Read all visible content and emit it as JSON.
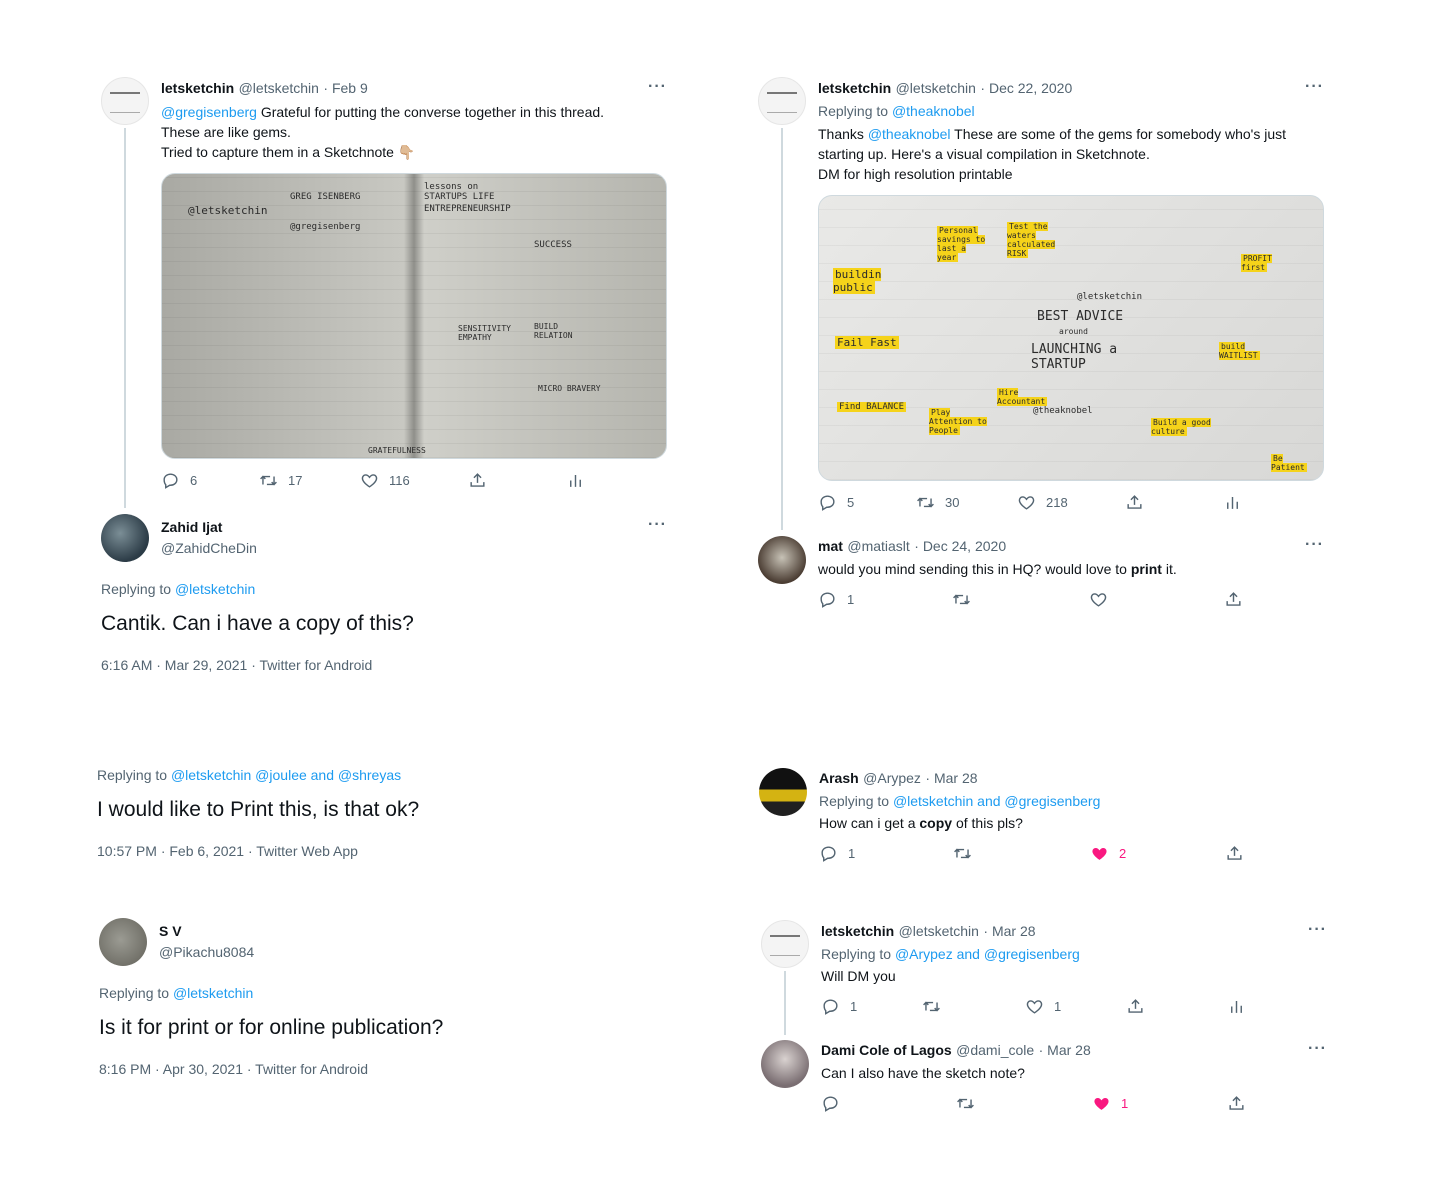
{
  "tweets": {
    "t1": {
      "name": "letsketchin",
      "handle": "@letsketchin",
      "date": "· Feb 9",
      "mention": "@gregisenberg",
      "line1_rest": " Grateful for putting the converse together in this thread.",
      "line2": "These are like gems.",
      "line3": "Tried to capture them in a Sketchnote 👇🏼",
      "stats": {
        "replies": "6",
        "retweets": "17",
        "likes": "116"
      },
      "sketch_labels": [
        "@letsketchin",
        "GREG ISENBERG",
        "@gregisenberg",
        "lessons on STARTUPS LIFE",
        "ENTREPRENEURSHIP",
        "SUCCESS",
        "SENSITIVITY EMPATHY",
        "BUILD RELATION",
        "MICRO BRAVERY",
        "GRATEFULNESS"
      ]
    },
    "t2": {
      "name": "Zahid Ijat",
      "handle": "@ZahidCheDin",
      "replying_prefix": "Replying to ",
      "replying_to": "@letsketchin",
      "text": "Cantik. Can i have a copy of this?",
      "timestamp": "6:16 AM · Mar 29, 2021 · Twitter for Android"
    },
    "t3": {
      "replying_prefix": "Replying to ",
      "replying_to": "@letsketchin @joulee and @shreyas",
      "text": "I would like to Print this, is that ok?",
      "timestamp": "10:57 PM · Feb 6, 2021 · Twitter Web App"
    },
    "t4": {
      "name": "S V",
      "handle": "@Pikachu8084",
      "replying_prefix": "Replying to ",
      "replying_to": "@letsketchin",
      "text": "Is it for print or for online publication?",
      "timestamp": "8:16 PM · Apr 30, 2021 · Twitter for Android"
    },
    "t5": {
      "name": "letsketchin",
      "handle": "@letsketchin",
      "date": "· Dec 22, 2020",
      "replying_prefix": "Replying to ",
      "replying_to": "@theaknobel",
      "line1_pre": "Thanks ",
      "mention": "@theaknobel",
      "line1_rest": " These are some of the gems for somebody who's just",
      "line2": "starting up. Here's a visual compilation in Sketchnote.",
      "line3": "DM for high resolution printable",
      "stats": {
        "replies": "5",
        "retweets": "30",
        "likes": "218"
      },
      "sketch_labels": [
        "Personal savings to last a year",
        "Test the waters calculated RISK",
        "buildin public",
        "BEST ADVICE",
        "around",
        "LAUNCHING a STARTUP",
        "@letsketchin",
        "@theaknobel",
        "Fail Fast",
        "Find BALANCE",
        "PROFIT first",
        "build WAITLIST",
        "Be Patient",
        "Hire Accountant",
        "Play Attention to People",
        "Build a good culture"
      ]
    },
    "t6": {
      "name": "mat",
      "handle": "@matiaslt",
      "date": "· Dec 24, 2020",
      "text_pre": "would you mind sending this in HQ? would love to ",
      "text_bold": "print",
      "text_post": " it.",
      "stats": {
        "replies": "1"
      }
    },
    "t7": {
      "name": "Arash",
      "handle": "@Arypez",
      "date": "· Mar 28",
      "replying_prefix": "Replying to ",
      "replying_to": "@letsketchin and @gregisenberg",
      "text_pre": "How can i get a ",
      "text_bold": "copy",
      "text_post": " of this pls?",
      "stats": {
        "replies": "1",
        "likes": "2"
      }
    },
    "t8": {
      "name": "letsketchin",
      "handle": "@letsketchin",
      "date": "· Mar 28",
      "replying_prefix": "Replying to ",
      "replying_to": "@Arypez and @gregisenberg",
      "text": "Will DM you",
      "stats": {
        "replies": "1",
        "likes": "1"
      }
    },
    "t9": {
      "name": "Dami Cole of Lagos",
      "handle": "@dami_cole",
      "date": "· Mar 28",
      "text": "Can I also have the sketch note?",
      "stats": {
        "likes": "1"
      }
    }
  },
  "more_glyph": "···",
  "colors": {
    "accent": "#1d9bf0",
    "like": "#f91880",
    "muted": "#536471",
    "text": "#0f1419"
  },
  "icons": [
    "reply-icon",
    "retweet-icon",
    "like-icon",
    "share-icon",
    "analytics-icon",
    "more-icon"
  ]
}
